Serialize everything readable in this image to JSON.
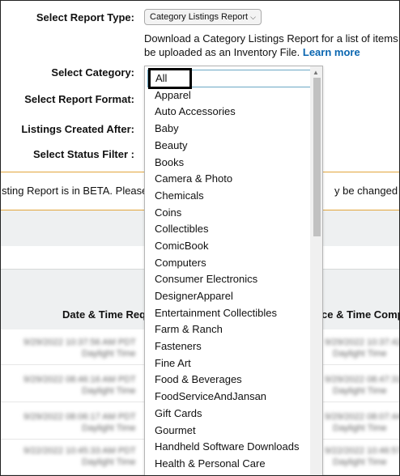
{
  "form": {
    "report_type_label": "Select Report Type:",
    "report_type_value": "Category Listings Report",
    "description_line1": "Download a Category Listings Report for a list of items",
    "description_line2": "be uploaded as an Inventory File.",
    "learn_more": "Learn more",
    "category_label": "Select Category:",
    "format_label": "Select Report Format:",
    "created_after_label": "Listings Created After:",
    "status_filter_label": "Select Status Filter :"
  },
  "banner": {
    "left_text": "sting Report is in BETA. Please r",
    "right_text": "y be changed or"
  },
  "table": {
    "col_requested": "Date & Time Req",
    "col_completed": "ce & Time Compl",
    "rows": [
      {
        "left_top": "9/29/2022 10:37:56 AM PDT",
        "left_bottom": "Daylight Time",
        "right_top": "9/29/2022 10:37:42 AM",
        "right_bottom": "Daylight Time"
      },
      {
        "left_top": "9/29/2022 08:46:16 AM PDT",
        "left_bottom": "Daylight Time",
        "right_top": "9/29/2022 08:47:31 AM",
        "right_bottom": "Daylight Time"
      },
      {
        "left_top": "9/29/2022 08:06:17 AM PDT",
        "left_bottom": "Daylight Time",
        "right_top": "9/29/2022 08:07:44 AM",
        "right_bottom": "Daylight Time"
      },
      {
        "left_top": "9/22/2022 10:45:33 AM PDT",
        "left_bottom": "Daylight Time",
        "right_top": "9/22/2022 10:46:57 AM",
        "right_bottom": "Daylight Time"
      }
    ]
  },
  "dropdown": {
    "selected": "All",
    "options": [
      "Apparel",
      "Auto Accessories",
      "Baby",
      "Beauty",
      "Books",
      "Camera & Photo",
      "Chemicals",
      "Coins",
      "Collectibles",
      "ComicBook",
      "Computers",
      "Consumer Electronics",
      "DesignerApparel",
      "Entertainment Collectibles",
      "Farm & Ranch",
      "Fasteners",
      "Fine Art",
      "Food & Beverages",
      "FoodServiceAndJansan",
      "Gift Cards",
      "Gourmet",
      "Handheld Software Downloads",
      "Health & Personal Care"
    ]
  }
}
